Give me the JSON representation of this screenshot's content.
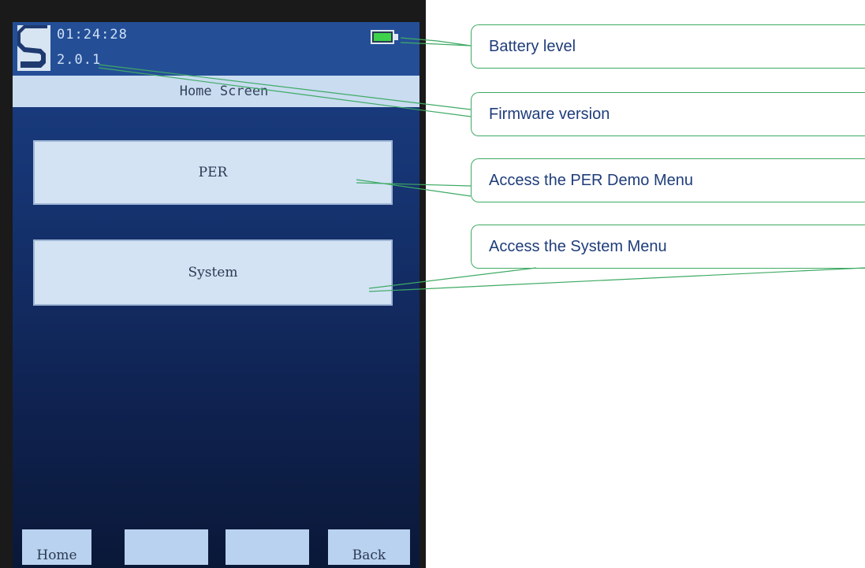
{
  "device": {
    "clock": "01:24:28",
    "firmware": "2.0.1",
    "screen_title": "Home Screen",
    "menu": {
      "per_label": "PER",
      "system_label": "System"
    },
    "soft_keys": [
      "Home",
      "",
      "",
      "Back"
    ],
    "battery_color": "#3ed14a"
  },
  "callouts": [
    "Battery level",
    "Firmware version",
    "Access the PER Demo Menu",
    "Access the System Menu"
  ],
  "colors": {
    "callout_line": "#3eaa64",
    "callout_text": "#1f3d7a",
    "screen_blue": "#15326e"
  }
}
